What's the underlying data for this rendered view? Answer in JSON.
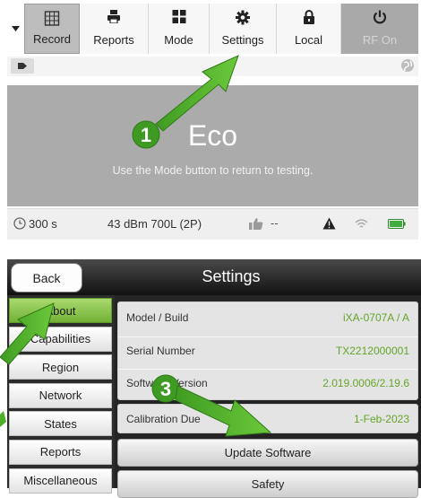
{
  "toolbar": {
    "items": [
      {
        "label": "Record",
        "icon": "record-grid-icon"
      },
      {
        "label": "Reports",
        "icon": "printer-icon"
      },
      {
        "label": "Mode",
        "icon": "grid-icon"
      },
      {
        "label": "Settings",
        "icon": "gear-icon"
      },
      {
        "label": "Local",
        "icon": "lock-icon"
      },
      {
        "label": "RF On",
        "icon": "power-icon"
      }
    ],
    "dropdown_icon": "caret-down-icon"
  },
  "tag_strip": {
    "left_icon": "tag-icon",
    "right_icon": "globe-icon"
  },
  "eco": {
    "title": "Eco",
    "hint": "Use the Mode button to return to testing."
  },
  "status_bar": {
    "timer": "300 s",
    "level": "43 dBm 700L (2P)",
    "marker": "--",
    "icons": [
      "clock-icon",
      "thumbs-up-icon",
      "warning-icon",
      "wifi-icon",
      "battery-icon"
    ]
  },
  "settings": {
    "back_label": "Back",
    "title": "Settings",
    "nav": [
      "About",
      "Capabilities",
      "Region",
      "Network",
      "States",
      "Reports",
      "Miscellaneous"
    ],
    "active_nav": "About",
    "info": [
      {
        "key": "Model / Build",
        "value": "iXA-0707A / A"
      },
      {
        "key": "Serial Number",
        "value": "TX2212000001"
      },
      {
        "key": "Software Version",
        "value": "2.019.0006/2.19.6"
      }
    ],
    "calibration": {
      "key": "Calibration Due",
      "value": "1-Feb-2023"
    },
    "update_label": "Update Software",
    "safety_label": "Safety"
  },
  "annotations": {
    "callouts": [
      "1",
      "3"
    ],
    "accent_color": "#4caf2a"
  }
}
